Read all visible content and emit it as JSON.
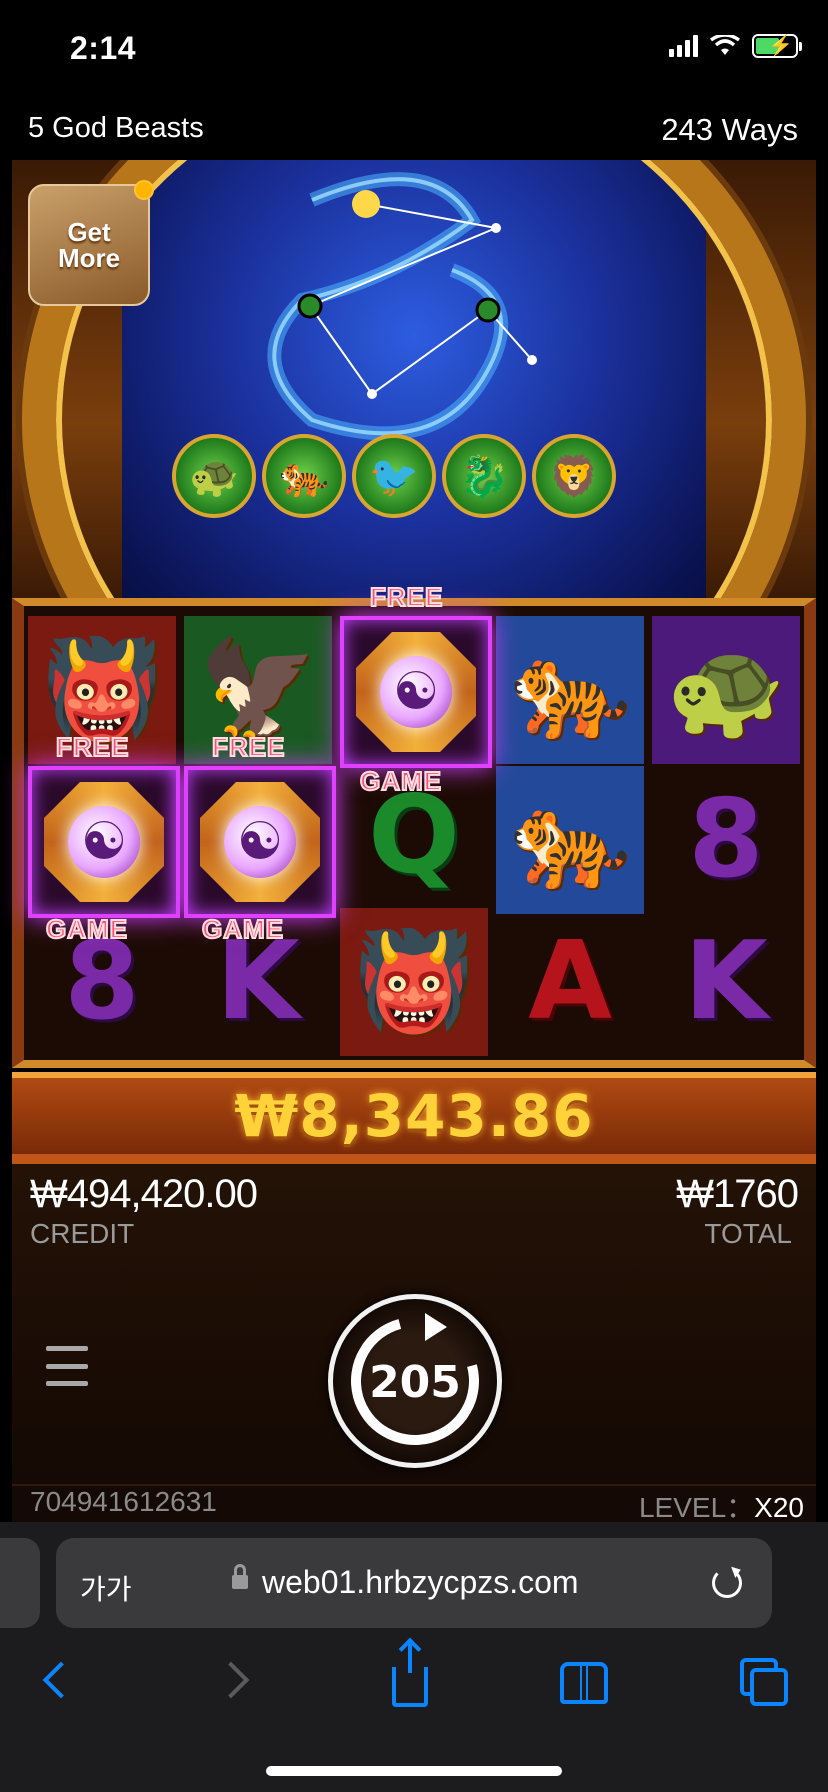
{
  "status_bar": {
    "time": "2:14"
  },
  "game": {
    "title": "5 God Beasts",
    "ways": "243 Ways",
    "get_more": {
      "line1": "Get",
      "line2": "More"
    },
    "beast_icons": [
      "beast-1-icon",
      "beast-2-icon",
      "beast-3-icon",
      "beast-4-icon",
      "beast-5-icon"
    ]
  },
  "reels": {
    "scatter_top_label": "FREE",
    "scatter_bottom_label": "GAME",
    "symbols": {
      "q": "Q",
      "eight": "8",
      "k": "K",
      "a": "A"
    }
  },
  "win": {
    "amount": "₩8,343.86"
  },
  "credit": {
    "value": "₩494,420.00",
    "label": "CREDIT"
  },
  "total": {
    "value": "₩1760",
    "label": "TOTAL"
  },
  "spin": {
    "free_spins_left": "205"
  },
  "footer": {
    "round_id": "704941612631",
    "level_label": "LEVEL：",
    "level_value": "X20"
  },
  "browser": {
    "text_size_label": "가가",
    "url": "web01.hrbzycpzs.com"
  },
  "colors": {
    "win_gold": "#ffd23a",
    "scatter_glow": "#e040ff",
    "ios_blue": "#0a84ff"
  }
}
